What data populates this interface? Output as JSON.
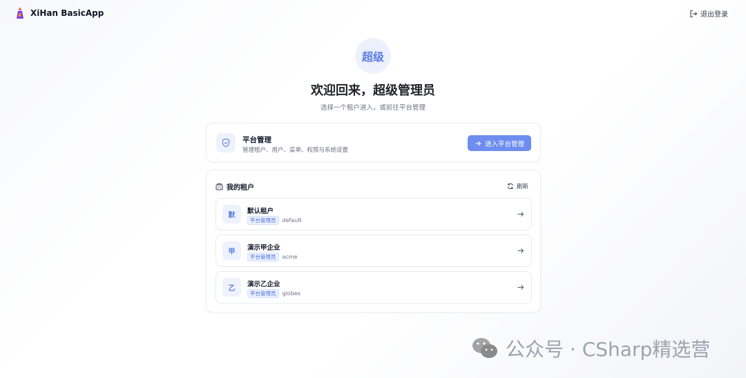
{
  "app": {
    "name": "XiHan BasicApp"
  },
  "header": {
    "logout_label": "退出登录"
  },
  "welcome": {
    "avatar_text": "超级",
    "title": "欢迎回来，超级管理员",
    "subtitle": "选择一个租户进入，或前往平台管理"
  },
  "platform": {
    "title": "平台管理",
    "description": "管理租户、用户、菜单、权限与系统设置",
    "enter_label": "进入平台管理"
  },
  "tenants": {
    "title": "我的租户",
    "refresh_label": "刷新",
    "items": [
      {
        "icon_text": "默",
        "name": "默认租户",
        "role": "平台管理员",
        "code": "default"
      },
      {
        "icon_text": "甲",
        "name": "演示甲企业",
        "role": "平台管理员",
        "code": "acme"
      },
      {
        "icon_text": "乙",
        "name": "演示乙企业",
        "role": "平台管理员",
        "code": "globex"
      }
    ]
  },
  "watermark": {
    "text": "公众号 · CSharp精选营"
  },
  "colors": {
    "accent": "#6d8ef0",
    "accent_text": "#5b7ee5",
    "badge_bg": "#eaf0fe"
  }
}
